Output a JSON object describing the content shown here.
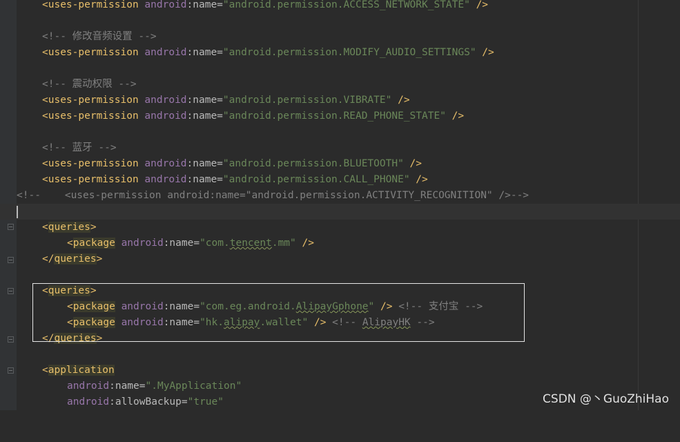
{
  "colors": {
    "background": "#2b2b2b",
    "tag": "#e8bf6a",
    "namespace": "#9876aa",
    "string": "#6a8759",
    "comment": "#808080",
    "selection_border": "#e6e6e6"
  },
  "lines": {
    "l1": {
      "tag": "<uses-permission",
      "ns": "android",
      "attr": ":name=",
      "val": "\"android.permission.ACCESS_NETWORK_STATE\"",
      "end": " />"
    },
    "c1": "<!-- 修改音频设置 -->",
    "l2": {
      "tag": "<uses-permission",
      "ns": "android",
      "attr": ":name=",
      "val": "\"android.permission.MODIFY_AUDIO_SETTINGS\"",
      "end": " />"
    },
    "c2": "<!-- 震动权限 -->",
    "l3": {
      "tag": "<uses-permission",
      "ns": "android",
      "attr": ":name=",
      "val": "\"android.permission.VIBRATE\"",
      "end": " />"
    },
    "l4": {
      "tag": "<uses-permission",
      "ns": "android",
      "attr": ":name=",
      "val": "\"android.permission.READ_PHONE_STATE\"",
      "end": " />"
    },
    "c3": "<!-- 蓝牙 -->",
    "l5": {
      "tag": "<uses-permission",
      "ns": "android",
      "attr": ":name=",
      "val": "\"android.permission.BLUETOOTH\"",
      "end": " />"
    },
    "l6": {
      "tag": "<uses-permission",
      "ns": "android",
      "attr": ":name=",
      "val": "\"android.permission.CALL_PHONE\"",
      "end": " />"
    },
    "c4": "<!--    <uses-permission android:name=\"android.permission.ACTIVITY_RECOGNITION\" />-->",
    "q1_open_lt": "<",
    "q1_open_name": "queries",
    "q1_open_gt": ">",
    "p1": {
      "lt": "<",
      "name": "package",
      "ns": "android",
      "attr": ":name=",
      "val_q1": "\"com.",
      "val_sq": "tencent",
      "val_rest": ".mm\"",
      "end": " />"
    },
    "q1_close_lt": "</",
    "q1_close_name": "queries",
    "q1_close_gt": ">",
    "q2_open_lt": "<",
    "q2_open_name": "queries",
    "q2_open_gt": ">",
    "p2": {
      "lt": "<",
      "name": "package",
      "ns": "android",
      "attr": ":name=",
      "val_a": "\"com.eg.android.",
      "val_sq": "AlipayGphone",
      "val_b": "\"",
      "end": " />",
      "cmt": " <!-- 支付宝 -->"
    },
    "p3": {
      "lt": "<",
      "name": "package",
      "ns": "android",
      "attr": ":name=",
      "val_a": "\"hk.",
      "val_sq": "alipay",
      "val_b": ".wallet\"",
      "end": " />",
      "cmt_a": " <!-- ",
      "cmt_sq": "AlipayHK",
      "cmt_b": " -->"
    },
    "q2_close_lt": "</",
    "q2_close_name": "queries",
    "q2_close_gt": ">",
    "app_lt": "<",
    "app_name": "application",
    "a1": {
      "ns": "android",
      "attr": ":name=",
      "val": "\".MyApplication\""
    },
    "a2": {
      "ns": "android",
      "attr": ":allowBackup=",
      "val": "\"true\""
    }
  },
  "watermark": "CSDN @丶GuoZhiHao"
}
